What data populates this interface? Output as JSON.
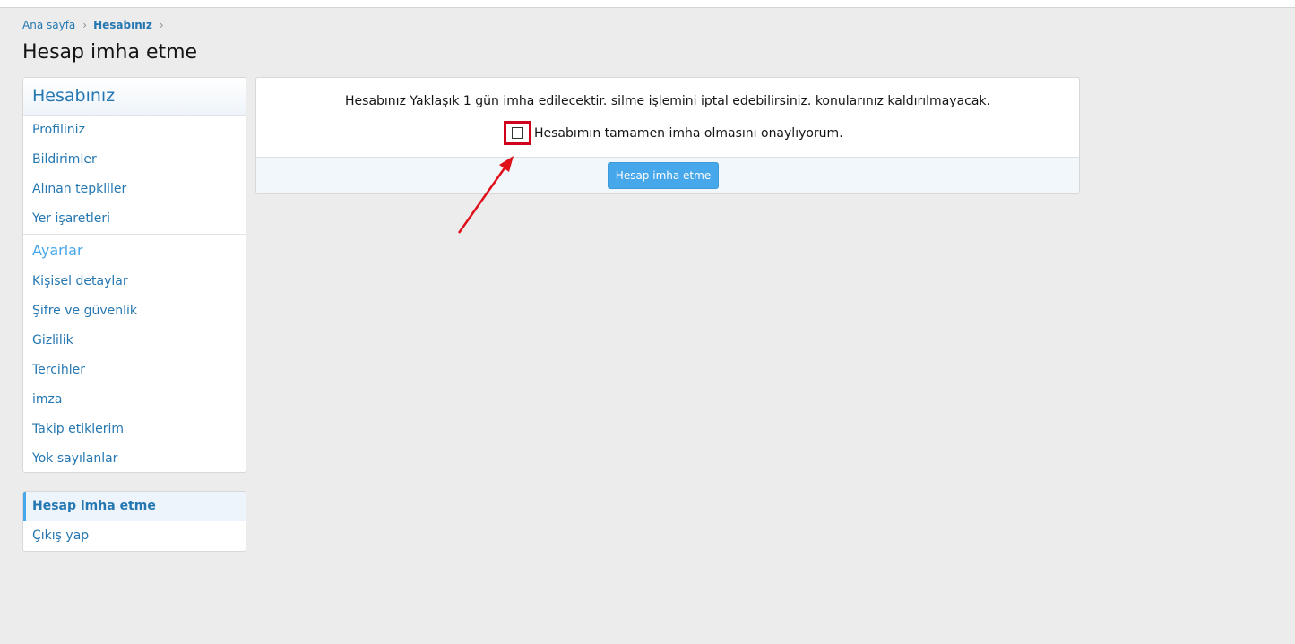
{
  "breadcrumb": {
    "home": "Ana sayfa",
    "current": "Hesabınız"
  },
  "page_title": "Hesap imha etme",
  "sidebar": {
    "header": "Hesabınız",
    "items": [
      {
        "label": "Profiliniz"
      },
      {
        "label": "Bildirimler"
      },
      {
        "label": "Alınan tepkliler"
      },
      {
        "label": "Yer işaretleri"
      }
    ],
    "settings_header": "Ayarlar",
    "settings_items": [
      {
        "label": "Kişisel detaylar"
      },
      {
        "label": "Şifre ve güvenlik"
      },
      {
        "label": "Gizlilik"
      },
      {
        "label": "Tercihler"
      },
      {
        "label": "imza"
      },
      {
        "label": "Takip etiklerim"
      },
      {
        "label": "Yok sayılanlar"
      }
    ],
    "account_items": [
      {
        "label": "Hesap imha etme",
        "active": true
      },
      {
        "label": "Çıkış yap"
      }
    ]
  },
  "content": {
    "notice": "Hesabınız Yaklaşık 1 gün imha edilecektir. silme işlemini iptal edebilirsiniz. konularınız kaldırılmayacak.",
    "confirm_label": "Hesabımın tamamen imha olmasını onaylıyorum.",
    "confirm_checked": false,
    "submit_label": "Hesap imha etme"
  },
  "colors": {
    "accent": "#47a7eb",
    "link": "#2577b1",
    "highlight": "#d0021b"
  }
}
